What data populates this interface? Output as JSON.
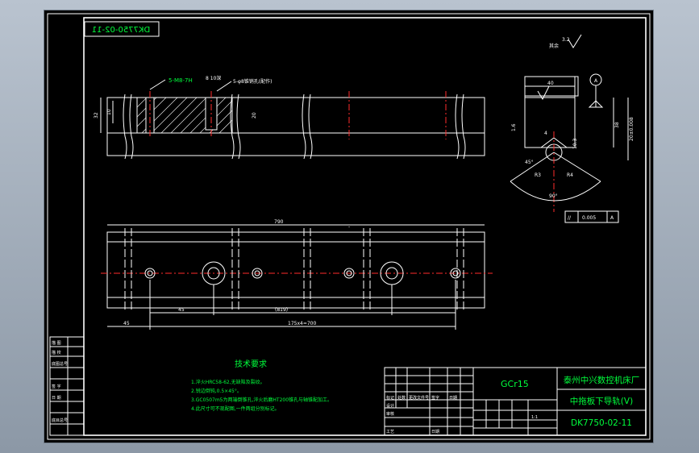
{
  "drawing": {
    "code_mirrored": "DK7750-02-11",
    "roughness": "其余",
    "roughness_value": "3.2",
    "datum": "A"
  },
  "front_view": {
    "thread_label": "5-M8-7H",
    "depth_label": "8 10深",
    "hole_label": "5-φ8锥销孔(配作)",
    "dim_left_outer": "32",
    "dim_left_inner": "10",
    "dim_right": "20"
  },
  "top_view": {
    "overall_length": "790",
    "dim_first_hole": "45",
    "dim_total_pitch": "175x4=700",
    "dim_start": "45",
    "dim_mid": "(819)",
    "dash_mark": "-"
  },
  "section": {
    "width": "40",
    "height": "38",
    "chamfer": "1.6",
    "fit": "20±0.008",
    "groove_depth": "4",
    "groove_dim": "10.3",
    "angle": "90°",
    "angle_small": "45°",
    "radius_a": "R3",
    "radius_b": "R4",
    "tolerance_symbol": "//",
    "tolerance_value": "0.005",
    "tolerance_datum": "A"
  },
  "notes": {
    "title": "技术要求",
    "items": [
      "1.淬火HRC58-62,无缺陷及裂纹。",
      "2.锐边倒钝,0.5×45°。",
      "3.GC0507m5为两端倒锥孔,淬火后磨HT200锥孔与轴锥配加工。",
      "4.此尺寸可不现配图,一件两组分别标记。"
    ]
  },
  "title_block": {
    "material": "GCr15",
    "company": "泰州中兴数控机床厂",
    "part_name": "中拖板下导轨(V)",
    "drawing_no": "DK7750-02-11",
    "scale": "1:1",
    "row_labels": [
      "标记",
      "处数",
      "更改文件号",
      "签字",
      "日期"
    ],
    "sign_labels": [
      "设计",
      "审核",
      "工艺",
      "批准"
    ],
    "date_label": "日期"
  },
  "side_block": {
    "labels": [
      "描 图",
      "描 校",
      "底图总号",
      "签 字",
      "日 期",
      "底目总号"
    ]
  }
}
